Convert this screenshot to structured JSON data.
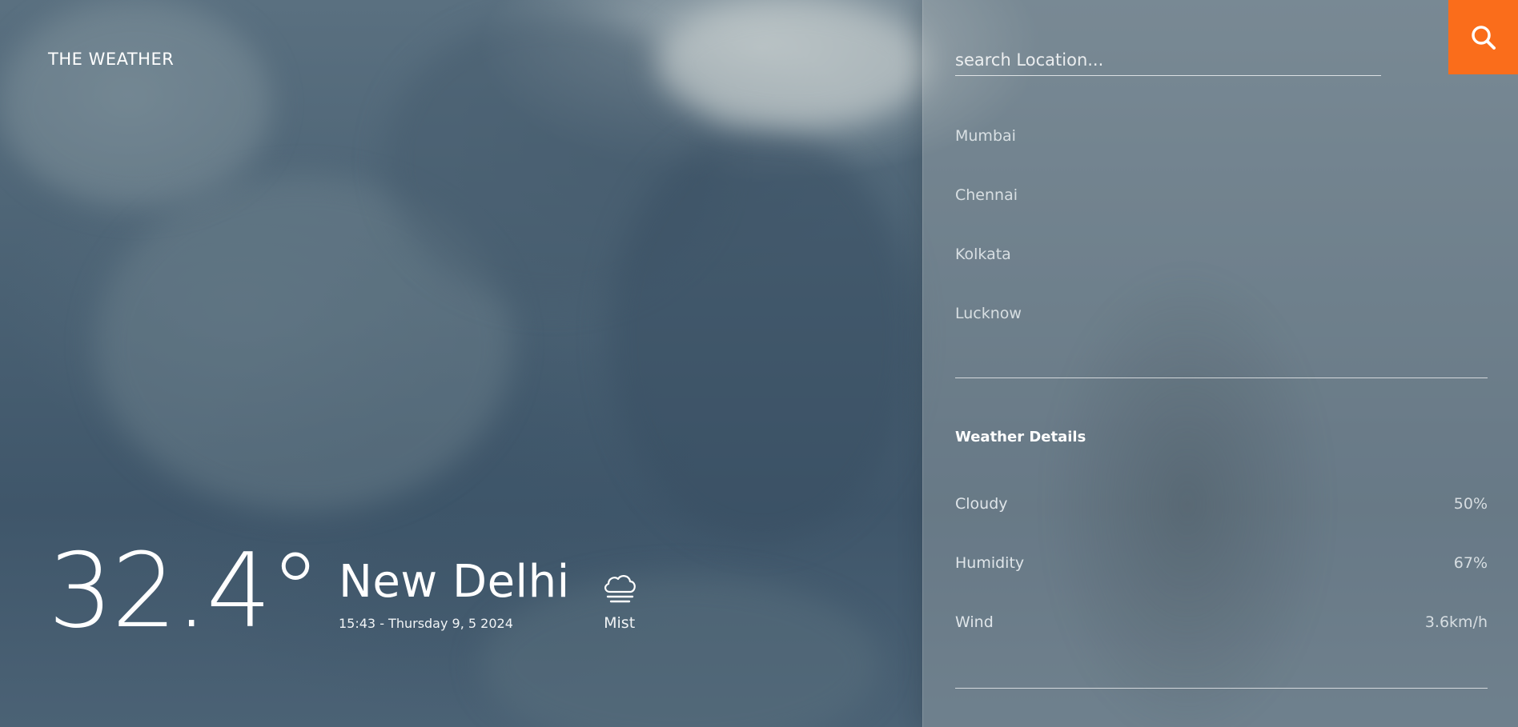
{
  "app": {
    "logo": "THE WEATHER"
  },
  "current": {
    "temperature": "32.4°",
    "city": "New Delhi",
    "datetime": "15:43 - Thursday 9, 5 2024",
    "condition": "Mist",
    "condition_icon": "cloud-mist-icon"
  },
  "search": {
    "placeholder": "search Location...",
    "value": "",
    "button_icon": "search-icon",
    "button_color": "#fa6d1b"
  },
  "locations": [
    "Mumbai",
    "Chennai",
    "Kolkata",
    "Lucknow"
  ],
  "details": {
    "title": "Weather Details",
    "rows": [
      {
        "label": "Cloudy",
        "value": "50%"
      },
      {
        "label": "Humidity",
        "value": "67%"
      },
      {
        "label": "Wind",
        "value": "3.6km/h"
      }
    ]
  }
}
